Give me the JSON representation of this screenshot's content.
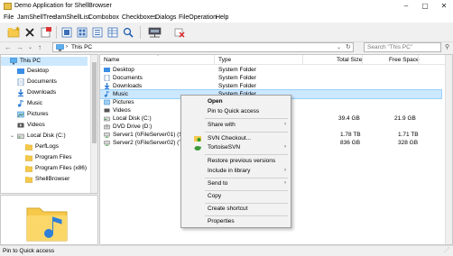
{
  "window": {
    "title": "Demo Application for ShellBrowser",
    "buttons": [
      "–",
      "▢",
      "✕"
    ]
  },
  "menubar": [
    "File",
    "JamShellTree",
    "JamShellList",
    "Combobox",
    "Checkboxes",
    "Dialogs",
    "FileOperation",
    "Help"
  ],
  "address": {
    "location": "This PC",
    "search_placeholder": "Search \"This PC\""
  },
  "tree": [
    {
      "label": "This PC",
      "icon": "pc-icon"
    },
    {
      "label": "Desktop",
      "icon": "desktop-icon"
    },
    {
      "label": "Documents",
      "icon": "documents-icon"
    },
    {
      "label": "Downloads",
      "icon": "downloads-icon"
    },
    {
      "label": "Music",
      "icon": "music-icon"
    },
    {
      "label": "Pictures",
      "icon": "pictures-icon"
    },
    {
      "label": "Videos",
      "icon": "videos-icon"
    },
    {
      "label": "Local Disk (C:)",
      "icon": "disk-icon"
    },
    {
      "label": "PerfLogs",
      "icon": "folder-icon"
    },
    {
      "label": "Program Files",
      "icon": "folder-icon"
    },
    {
      "label": "Program Files (x86)",
      "icon": "folder-icon"
    },
    {
      "label": "ShellBrowser",
      "icon": "folder-icon"
    }
  ],
  "list": {
    "columns": {
      "name": "Name",
      "type": "Type",
      "total": "Total Size",
      "free": "Free Space"
    },
    "rows": [
      {
        "name": "Desktop",
        "type": "System Folder",
        "total": "",
        "free": ""
      },
      {
        "name": "Documents",
        "type": "System Folder",
        "total": "",
        "free": ""
      },
      {
        "name": "Downloads",
        "type": "System Folder",
        "total": "",
        "free": ""
      },
      {
        "name": "Music",
        "type": "System Folder",
        "total": "",
        "free": ""
      },
      {
        "name": "Pictures",
        "type": "",
        "total": "",
        "free": ""
      },
      {
        "name": "Videos",
        "type": "",
        "total": "",
        "free": ""
      },
      {
        "name": "Local Disk (C:)",
        "type": "",
        "total": "39.4 GB",
        "free": "21.9 GB"
      },
      {
        "name": "DVD Drive (D:)",
        "type": "",
        "total": "",
        "free": ""
      },
      {
        "name": "Server1 (\\\\FileServer01) (S:)",
        "type": "",
        "total": "1.78 TB",
        "free": "1.71 TB"
      },
      {
        "name": "Server2 (\\\\FileServer02) (T:)",
        "type": "",
        "total": "836 GB",
        "free": "328 GB"
      }
    ]
  },
  "context_menu": {
    "items": [
      {
        "label": "Open",
        "bold": true
      },
      {
        "label": "Pin to Quick access"
      },
      {
        "sep": true
      },
      {
        "label": "Share with",
        "submenu": true
      },
      {
        "sep": true
      },
      {
        "label": "SVN Checkout...",
        "icon": "svn-checkout-icon"
      },
      {
        "label": "TortoiseSVN",
        "submenu": true,
        "icon": "tortoisesvn-icon"
      },
      {
        "sep": true
      },
      {
        "label": "Restore previous versions"
      },
      {
        "label": "Include in library",
        "submenu": true
      },
      {
        "sep": true
      },
      {
        "label": "Send to",
        "submenu": true
      },
      {
        "sep": true
      },
      {
        "label": "Copy"
      },
      {
        "sep": true
      },
      {
        "label": "Create shortcut"
      },
      {
        "sep": true
      },
      {
        "label": "Properties"
      }
    ]
  },
  "status": {
    "text": "Pin to Quick access"
  },
  "colors": {
    "selection": "#cce8ff",
    "selection_border": "#99d1ff",
    "folder": "#f6c94a",
    "music_note": "#2f7fd8"
  }
}
